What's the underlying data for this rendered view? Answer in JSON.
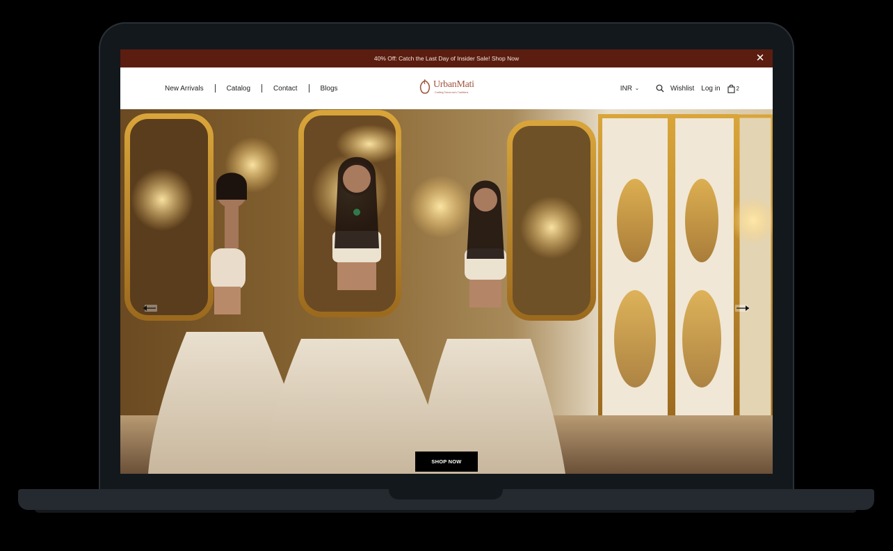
{
  "announcement": {
    "text": "40% Off: Catch the Last Day of Insider Sale! Shop Now",
    "close_icon": "close-icon"
  },
  "header": {
    "nav": [
      "New Arrivals",
      "Catalog",
      "Contact",
      "Blogs"
    ],
    "logo": {
      "name": "UrbanMati",
      "tagline": "Crafting Tomorrow's Traditions"
    },
    "currency": "INR",
    "wishlist": "Wishlist",
    "login": "Log in",
    "cart_count": "2"
  },
  "hero": {
    "cta": "SHOP NOW",
    "prev_icon": "arrow-left-icon",
    "next_icon": "arrow-right-icon"
  },
  "colors": {
    "announcement_bg": "#5b1d10",
    "brand": "#a0553e",
    "cta_bg": "#000000"
  }
}
